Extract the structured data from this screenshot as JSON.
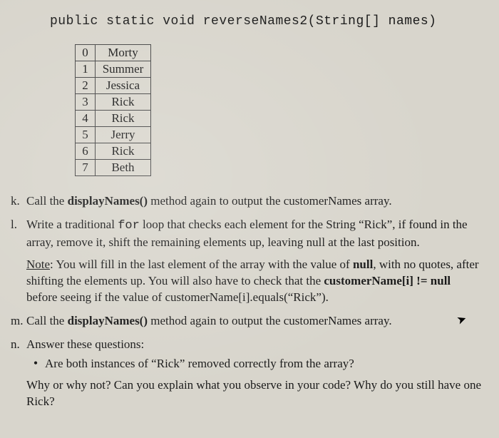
{
  "heading": "public static void reverseNames2(String[] names)",
  "array_rows": [
    {
      "index": "0",
      "value": "Morty"
    },
    {
      "index": "1",
      "value": "Summer"
    },
    {
      "index": "2",
      "value": "Jessica"
    },
    {
      "index": "3",
      "value": "Rick"
    },
    {
      "index": "4",
      "value": "Rick"
    },
    {
      "index": "5",
      "value": "Jerry"
    },
    {
      "index": "6",
      "value": "Rick"
    },
    {
      "index": "7",
      "value": "Beth"
    }
  ],
  "questions": {
    "k": {
      "label": "k.",
      "pre": "Call the ",
      "bold1": "displayNames()",
      "post": " method again to output the customerNames array."
    },
    "l": {
      "label": "l.",
      "line1_pre": "Write a traditional ",
      "line1_mono": "for",
      "line1_post": " loop that checks each element for the String “Rick”, if found in the array, remove it, shift the remaining elements up, leaving null at the last position.",
      "note_label": "Note",
      "note_text1": ": You will fill in the last element of the array with the value of ",
      "note_bold1": "null",
      "note_text2": ", with no quotes, after shifting the elements up.  You will also have to check that the ",
      "note_bold2": "customerName[i] != null",
      "note_text3": " before seeing if the value of customerName[i].equals(“Rick”)."
    },
    "m": {
      "label": "m.",
      "pre": "Call the ",
      "bold1": "displayNames()",
      "post": " method again to output the customerNames array."
    },
    "n": {
      "label": "n.",
      "intro": "Answer these questions:",
      "bullet1": "Are both instances of “Rick” removed correctly from the array?",
      "followup": "Why or why not?  Can you explain what you observe in your code?  Why do you still have one Rick?"
    }
  }
}
